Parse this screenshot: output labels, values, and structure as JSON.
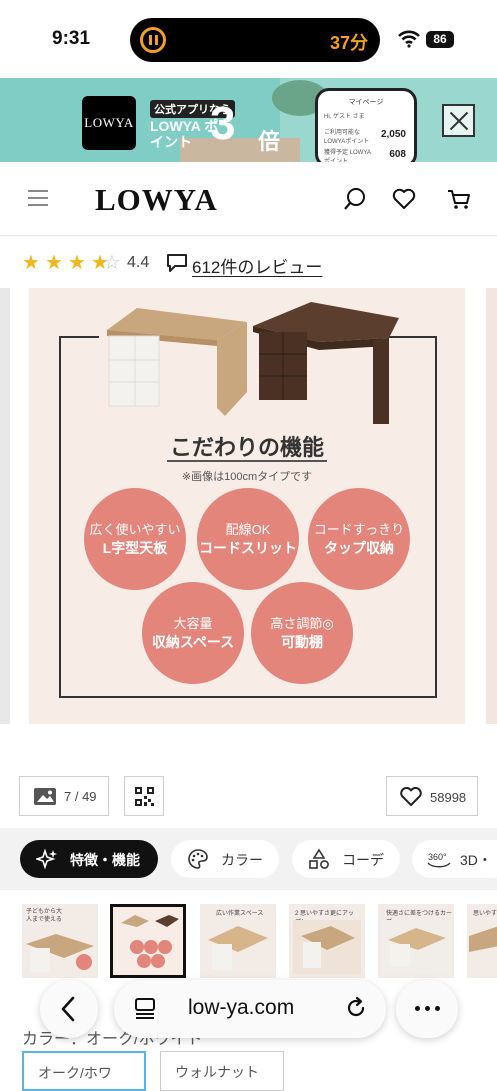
{
  "status_bar": {
    "time": "9:31",
    "timer": "37分",
    "battery": "86"
  },
  "app_banner": {
    "logo": "LOWYA",
    "line1": "公式アプリなら",
    "line2": "LOWYA ポイント",
    "multiplier": "3",
    "suffix": "倍",
    "phone_title": "マイページ",
    "phone_user": "Hi, ゲスト さま",
    "phone_row1_label": "ご利用可能な LOWYAポイント",
    "phone_row1_value": "2,050",
    "phone_row2_label": "獲得予定 LOWYAポイント",
    "phone_row2_value": "608"
  },
  "header": {
    "logo": "LOWYA"
  },
  "rating": {
    "score": "4.4",
    "stars": 4,
    "review_link": "612件のレビュー"
  },
  "product_image": {
    "title": "こだわりの機能",
    "note": "※画像は100cmタイプです",
    "features": [
      {
        "line1": "広く使いやすい",
        "line2": "L字型天板"
      },
      {
        "line1": "配線OK",
        "line2": "コードスリット"
      },
      {
        "line1": "コードすっきり",
        "line2": "タップ収納"
      },
      {
        "line1": "大容量",
        "line2": "収納スペース"
      },
      {
        "line1": "高さ調節◎",
        "line2": "可動棚"
      }
    ]
  },
  "toolbar": {
    "gallery_count": "7 / 49",
    "favorite_count": "58998"
  },
  "tabs": [
    {
      "label": "特徴・機能",
      "icon": "sparkle-icon"
    },
    {
      "label": "カラー",
      "icon": "palette-icon"
    },
    {
      "label": "コーデ",
      "icon": "shapes-icon"
    },
    {
      "label": "3D・",
      "icon": "360-icon"
    }
  ],
  "thumbnails": [
    {
      "caption": "子どもから大人まで使える"
    },
    {
      "caption": ""
    },
    {
      "caption": "広い作業スペース"
    },
    {
      "caption": "2 思いやすさ更にアップ！"
    },
    {
      "caption": "快適さに差をつけるカーブ"
    },
    {
      "caption": "思いやす"
    }
  ],
  "lower": {
    "label": "カラー：オーク/ホワイト",
    "options": [
      "オーク/ホワ",
      "ウォルナット"
    ]
  },
  "browser": {
    "url": "low-ya.com"
  },
  "colors": {
    "accent_circle": "#e4857c",
    "banner_bg": "#7fcdc4",
    "tab_active": "#111111"
  }
}
